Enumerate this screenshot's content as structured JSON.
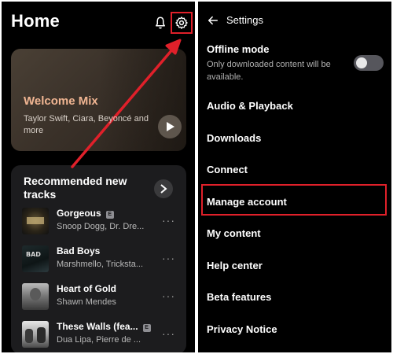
{
  "left": {
    "header": {
      "title": "Home"
    },
    "mix": {
      "title": "Welcome Mix",
      "subtitle": "Taylor Swift, Ciara, Beyoncé and more"
    },
    "recommended": {
      "title": "Recommended new tracks",
      "tracks": [
        {
          "title": "Gorgeous",
          "artist": "Snoop Dogg, Dr. Dre...",
          "explicit": true,
          "more": "···"
        },
        {
          "title": "Bad Boys",
          "artist": "Marshmello, Tricksta...",
          "explicit": false,
          "more": "···"
        },
        {
          "title": "Heart of Gold",
          "artist": "Shawn Mendes",
          "explicit": false,
          "more": "···"
        },
        {
          "title": "These Walls (fea...",
          "artist": "Dua Lipa, Pierre de ...",
          "explicit": true,
          "more": "···"
        }
      ],
      "explicit_badge": "E"
    }
  },
  "right": {
    "header": {
      "title": "Settings"
    },
    "offline": {
      "label": "Offline mode",
      "description": "Only downloaded content will be available.",
      "enabled": false
    },
    "options": [
      "Audio & Playback",
      "Downloads",
      "Connect",
      "Manage account",
      "My content",
      "Help center",
      "Beta features",
      "Privacy Notice"
    ]
  },
  "colors": {
    "highlight": "#e0202a",
    "mix_title": "#f0b592",
    "background": "#000000"
  }
}
